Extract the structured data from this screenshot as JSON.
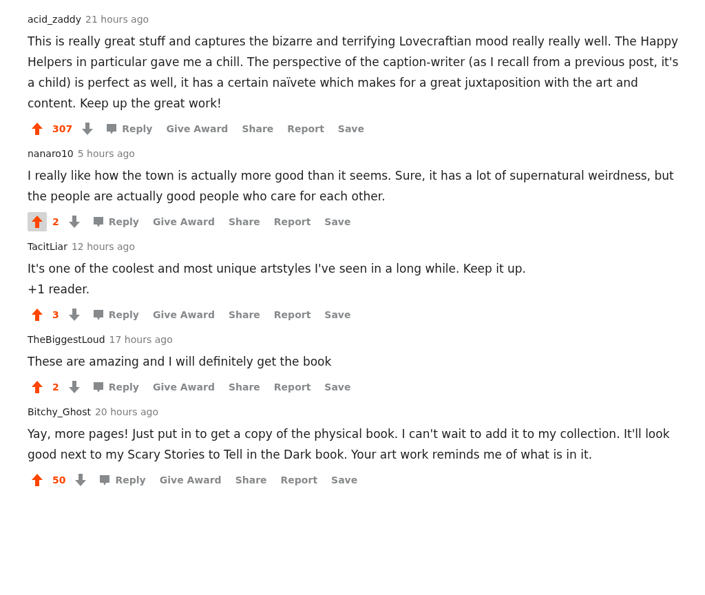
{
  "comments": [
    {
      "author": "acid_zaddy",
      "time": "21 hours ago",
      "body": [
        "This is really great stuff and captures the bizarre and terrifying Lovecraftian mood really really well. The Happy Helpers in particular gave me a chill. The perspective of the caption-writer (as I recall from a previous post, it's a child) is perfect as well, it has a certain naïvete which makes for a great juxtaposition with the art and content. Keep up the great work!"
      ],
      "score": "307",
      "upvoted": true,
      "upvote_highlighted": false,
      "actions": [
        "Reply",
        "Give Award",
        "Share",
        "Report",
        "Save"
      ]
    },
    {
      "author": "nanaro10",
      "time": "5 hours ago",
      "body": [
        "I really like how the town is actually more good than it seems. Sure, it has a lot of supernatural weirdness, but the people are actually good people who care for each other."
      ],
      "score": "2",
      "upvoted": true,
      "upvote_highlighted": true,
      "actions": [
        "Reply",
        "Give Award",
        "Share",
        "Report",
        "Save"
      ]
    },
    {
      "author": "TacitLiar",
      "time": "12 hours ago",
      "body": [
        "It's one of the coolest and most unique artstyles I've seen in a long while. Keep it up.",
        "+1 reader."
      ],
      "score": "3",
      "upvoted": true,
      "upvote_highlighted": false,
      "actions": [
        "Reply",
        "Give Award",
        "Share",
        "Report",
        "Save"
      ]
    },
    {
      "author": "TheBiggestLoud",
      "time": "17 hours ago",
      "body": [
        "These are amazing and I will definitely get the book"
      ],
      "score": "2",
      "upvoted": true,
      "upvote_highlighted": false,
      "actions": [
        "Reply",
        "Give Award",
        "Share",
        "Report",
        "Save"
      ]
    },
    {
      "author": "Bitchy_Ghost",
      "time": "20 hours ago",
      "body": [
        "Yay, more pages! Just put in to get a copy of the physical book. I can't wait to add it to my collection. It'll look good next to my Scary Stories to Tell in the Dark book. Your art work reminds me of what is in it."
      ],
      "score": "50",
      "upvoted": true,
      "upvote_highlighted": false,
      "actions": [
        "Reply",
        "Give Award",
        "Share",
        "Report",
        "Save"
      ]
    }
  ]
}
